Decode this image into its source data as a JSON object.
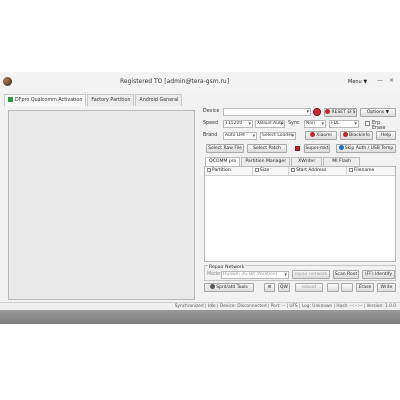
{
  "window": {
    "title": "Registered TO [admin@tera-gsm.ru]",
    "menu_label": "Menu ▼",
    "minimize": "—",
    "close": "×"
  },
  "left_tabs": [
    {
      "label": "DFpro Qualcomm Activation"
    },
    {
      "label": "Factory Partition"
    },
    {
      "label": "Android General"
    }
  ],
  "device": {
    "label": "Device",
    "value": "",
    "reset_efs": "RESET EFS",
    "options": "Options ▼"
  },
  "speed": {
    "label": "Speed",
    "value": "115200",
    "xbaud": "XBaud:Auto",
    "sync_label": "Sync",
    "sync_value": "Non",
    "protocol": "FDL",
    "erp_label": "Erp Erase"
  },
  "brand": {
    "label": "Brand",
    "value": "Auto Det",
    "model": "Select Loader",
    "buttons": [
      "Xiaomi",
      "BlockInfo",
      "Help"
    ]
  },
  "files": {
    "raw": "Select Raw File",
    "patch": "Select Patch",
    "super": "Super-mkt",
    "skip": "Skip Auth / USB Temp"
  },
  "tabs2": [
    {
      "label": "QCOMM pro"
    },
    {
      "label": "Partition Manager"
    },
    {
      "label": "XWriter"
    },
    {
      "label": "MI Flash"
    }
  ],
  "table_headers": [
    "Partition",
    "Size",
    "Start Address",
    "Filename"
  ],
  "repair": {
    "title": "Repair Network",
    "mode_label": "Mode:",
    "mode_value": "Huawei 3G Bit (Nvation)",
    "repair_button": "repair network",
    "scan_root": "Scan Root",
    "identify": "(FF) Identify"
  },
  "bottom_buttons": {
    "sprd": "Sprd/atd Tools",
    "qw": "QW",
    "reboot": "reboot",
    "erase": "Erase",
    "write": "Write"
  },
  "statusbar": {
    "text": "Synchronized | Idle | Device: Disconnected | Port: -- | UFS | Log: Unknown | Hash: --:--:-- | Version: 1.0.0"
  }
}
